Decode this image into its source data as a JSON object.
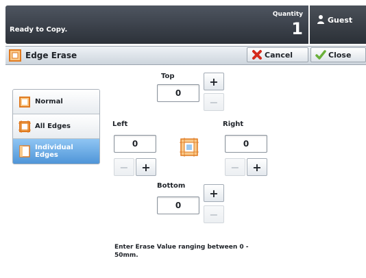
{
  "header": {
    "status": "Ready to Copy.",
    "quantity_label": "Quantity",
    "quantity_value": "1",
    "user_label": "Guest"
  },
  "title_bar": {
    "title": "Edge Erase",
    "cancel_label": "Cancel",
    "close_label": "Close"
  },
  "options": [
    {
      "label": "Normal",
      "selected": false
    },
    {
      "label": "All Edges",
      "selected": false
    },
    {
      "label": "Individual Edges",
      "selected": true
    }
  ],
  "edges": {
    "top": {
      "label": "Top",
      "value": "0"
    },
    "left": {
      "label": "Left",
      "value": "0"
    },
    "right": {
      "label": "Right",
      "value": "0"
    },
    "bottom": {
      "label": "Bottom",
      "value": "0"
    }
  },
  "buttons": {
    "plus": "+",
    "minus": "−"
  },
  "hint": "Enter Erase Value ranging between 0 - 50mm.",
  "colors": {
    "header_bg": "#3a4049",
    "selected_option": "#5a9fe0",
    "edge_icon": "#e07a20",
    "cancel_icon": "#d42a1c",
    "close_icon": "#6ab03a"
  },
  "icons": {
    "title": "edge-erase-icon",
    "cancel": "x-icon",
    "close": "checkmark-icon",
    "user": "person-icon"
  }
}
